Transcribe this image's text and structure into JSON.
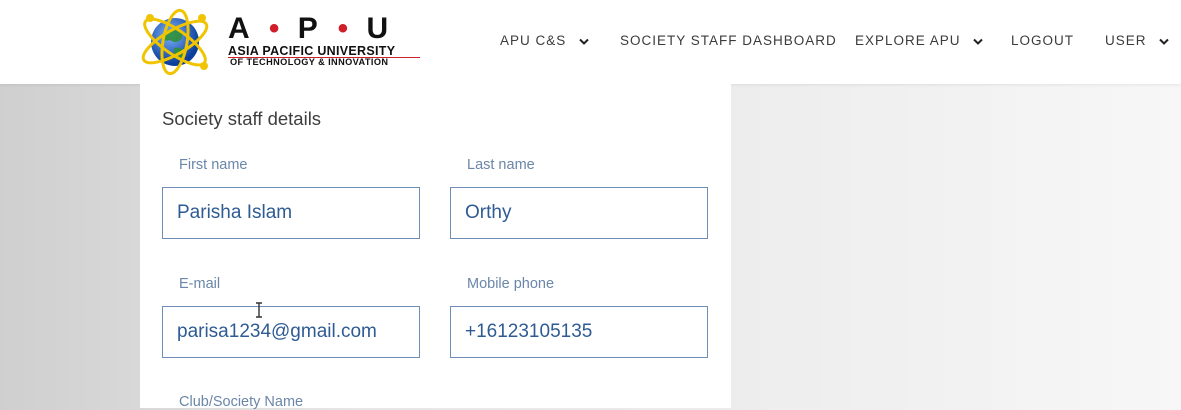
{
  "header": {
    "logo": {
      "brand_letters": [
        "A",
        "P",
        "U"
      ],
      "brand_dots": [
        "•",
        "•"
      ],
      "line1": "ASIA PACIFIC UNIVERSITY",
      "line2": "OF TECHNOLOGY & INNOVATION"
    },
    "nav": [
      {
        "label": "APU C&S",
        "has_dropdown": true
      },
      {
        "label": "SOCIETY STAFF DASHBOARD",
        "has_dropdown": false
      },
      {
        "label": "EXPLORE APU",
        "has_dropdown": true
      },
      {
        "label": "LOGOUT",
        "has_dropdown": false
      },
      {
        "label": "USER",
        "has_dropdown": true
      }
    ]
  },
  "form": {
    "section_title": "Society staff details",
    "fields": {
      "first_name": {
        "label": "First name",
        "value": "Parisha Islam"
      },
      "last_name": {
        "label": "Last name",
        "value": "Orthy"
      },
      "email": {
        "label": "E-mail",
        "value": "parisa1234@gmail.com"
      },
      "mobile": {
        "label": "Mobile phone",
        "value": "+16123105135"
      },
      "club": {
        "label": "Club/Society Name"
      }
    }
  },
  "colors": {
    "label": "#6a86a8",
    "input_text": "#2f5b93",
    "input_border": "#6e8cb4",
    "brand_red": "#d11f2a"
  },
  "icons": [
    "globe-logo-icon",
    "chevron-down-icon",
    "text-cursor-icon"
  ]
}
